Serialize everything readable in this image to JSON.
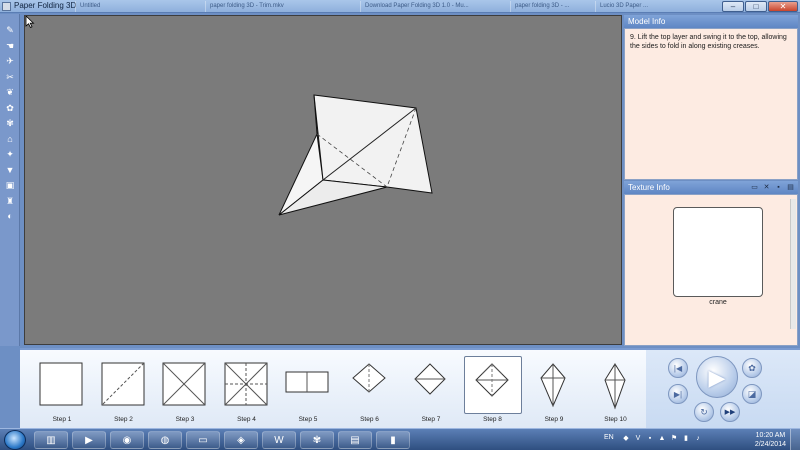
{
  "window": {
    "title": "Paper Folding 3D",
    "background_tabs": [
      "Untitled",
      "paper folding 3D - Trim.mkv",
      "Download Paper Folding 3D 1.0 - Mu...",
      "paper folding 3D - ...",
      "Lucio 3D Paper ..."
    ],
    "controls": {
      "minimize": "–",
      "maximize": "□",
      "close": "✕"
    }
  },
  "left_toolbar": {
    "tools": [
      {
        "name": "pencil-tool",
        "glyph": "✎"
      },
      {
        "name": "hand-tool",
        "glyph": "☚"
      },
      {
        "name": "crane-model",
        "glyph": "✈"
      },
      {
        "name": "fold-model",
        "glyph": "✂"
      },
      {
        "name": "fish-model",
        "glyph": "❦"
      },
      {
        "name": "butterfly-model",
        "glyph": "✿"
      },
      {
        "name": "frog-model",
        "glyph": "✾"
      },
      {
        "name": "house-model",
        "glyph": "⌂"
      },
      {
        "name": "star-model",
        "glyph": "✦"
      },
      {
        "name": "boat-model",
        "glyph": "▼"
      },
      {
        "name": "box-model",
        "glyph": "▣"
      },
      {
        "name": "cup-model",
        "glyph": "♜"
      },
      {
        "name": "info-model",
        "glyph": "◐"
      }
    ]
  },
  "model_info": {
    "title": "Model Info",
    "text": "9. Lift the top layer and swing it to the top, allowing the sides to fold in along existing creases."
  },
  "texture_info": {
    "title": "Texture Info",
    "tools": [
      {
        "name": "open-folder-icon",
        "glyph": "▭"
      },
      {
        "name": "delete-icon",
        "glyph": "✕"
      },
      {
        "name": "save-icon",
        "glyph": "▪"
      },
      {
        "name": "print-icon",
        "glyph": "▤"
      }
    ],
    "texture_name": "crane"
  },
  "steps": [
    {
      "label": "Step 1",
      "shape": "square-plain",
      "active": false
    },
    {
      "label": "Step 2",
      "shape": "square-diagonal",
      "active": false
    },
    {
      "label": "Step 3",
      "shape": "square-x",
      "active": false
    },
    {
      "label": "Step 4",
      "shape": "square-x-plus",
      "active": false
    },
    {
      "label": "Step 5",
      "shape": "rect-half",
      "active": false
    },
    {
      "label": "Step 6",
      "shape": "diamond-dashed",
      "active": false
    },
    {
      "label": "Step 7",
      "shape": "diamond-line",
      "active": false
    },
    {
      "label": "Step 8",
      "shape": "diamond-folded",
      "active": true
    },
    {
      "label": "Step 9",
      "shape": "kite",
      "active": false
    },
    {
      "label": "Step 10",
      "shape": "kite-tall",
      "active": false
    }
  ],
  "controls": {
    "rewind": "◀◀",
    "play": "▶",
    "next": "▶|",
    "back": "|◀",
    "repeat": "↻",
    "fast_forward": "▶▶",
    "butterfly": "✿",
    "camera": "◪"
  },
  "taskbar": {
    "apps": [
      {
        "name": "explorer-icon",
        "glyph": "▥"
      },
      {
        "name": "media-player-icon",
        "glyph": "▶"
      },
      {
        "name": "chrome-icon",
        "glyph": "◉"
      },
      {
        "name": "firefox-icon",
        "glyph": "◍"
      },
      {
        "name": "monitor-icon",
        "glyph": "▭"
      },
      {
        "name": "app-icon",
        "glyph": "◈"
      },
      {
        "name": "word-icon",
        "glyph": "W"
      },
      {
        "name": "frog-icon",
        "glyph": "✾"
      },
      {
        "name": "notepad-icon",
        "glyph": "▤"
      },
      {
        "name": "video-icon",
        "glyph": "▮"
      }
    ],
    "language": "EN",
    "time": "10:20 AM",
    "date": "2/24/2014"
  }
}
